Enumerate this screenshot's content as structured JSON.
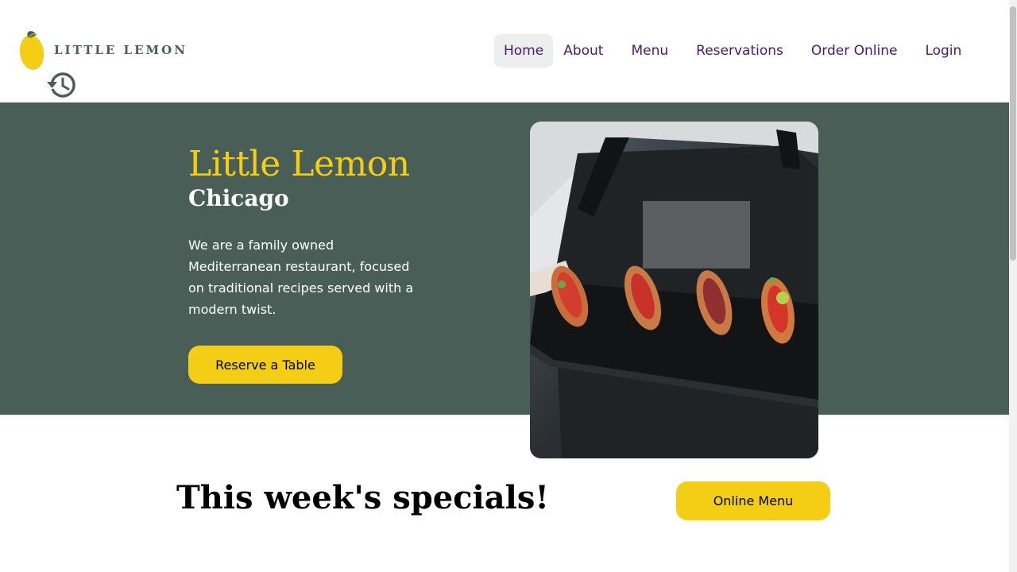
{
  "header": {
    "logo_text": "LITTLE LEMON",
    "logo_icon": "lemon-icon",
    "history_icon": "history-icon"
  },
  "nav": {
    "items": [
      {
        "label": "Home",
        "active": true
      },
      {
        "label": "About"
      },
      {
        "label": "Menu"
      },
      {
        "label": "Reservations"
      },
      {
        "label": "Order Online"
      },
      {
        "label": "Login"
      }
    ]
  },
  "hero": {
    "title": "Little Lemon",
    "subtitle": "Chicago",
    "description": "We are a family owned Mediterranean restaurant, focused on traditional recipes served with a modern twist.",
    "cta_label": "Reserve a Table"
  },
  "specials": {
    "title": "This week's specials!",
    "menu_button_label": "Online Menu"
  },
  "colors": {
    "primary_green": "#495e57",
    "primary_yellow": "#f4ce14",
    "nav_text": "#4b1875",
    "nav_active_bg": "#edefee"
  }
}
